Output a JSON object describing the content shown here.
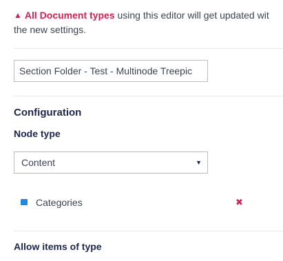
{
  "warning": {
    "icon": "warning-triangle-icon",
    "strong_text": "All Document types",
    "text_line1": " using this editor will get updated wit",
    "text_line2": "the new settings."
  },
  "name_input": {
    "value": "Section Folder - Test - Multinode Treepic"
  },
  "configuration": {
    "title": "Configuration",
    "node_type_label": "Node type",
    "node_type_selected": "Content",
    "node_item": {
      "label": "Categories",
      "icon": "folder-icon",
      "remove_icon": "remove-icon"
    },
    "allow_items_label": "Allow items of type"
  },
  "colors": {
    "accent": "#d42054",
    "text": "#1b264f",
    "border": "#bbbabf",
    "icon": "#1e88e5"
  }
}
